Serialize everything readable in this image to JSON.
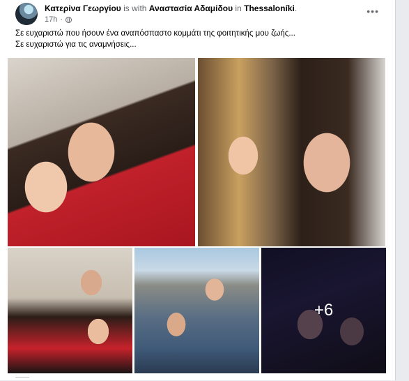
{
  "post": {
    "author": "Κατερίνα Γεωργίου",
    "with_text": "is with",
    "tagged": "Αναστασία Αδαμίδου",
    "in_text": "in",
    "place": "Thessaloníki",
    "period": ".",
    "time": "17h",
    "dot": "·",
    "more_label": "•••",
    "caption_line1": "Σε ευχαριστώ που ήσουν ένα αναπόσπαστο κομμάτι  της φοιτητικής μου ζωής...",
    "caption_line2": "Σε ευχαριστώ για τις αναμνήσεις..."
  },
  "gallery": {
    "photos": [
      "photo-1",
      "photo-2",
      "photo-3",
      "photo-4",
      "photo-5"
    ],
    "more_count_label": "+6"
  },
  "icons": {
    "privacy": "globe-icon",
    "options": "more-options-icon"
  }
}
